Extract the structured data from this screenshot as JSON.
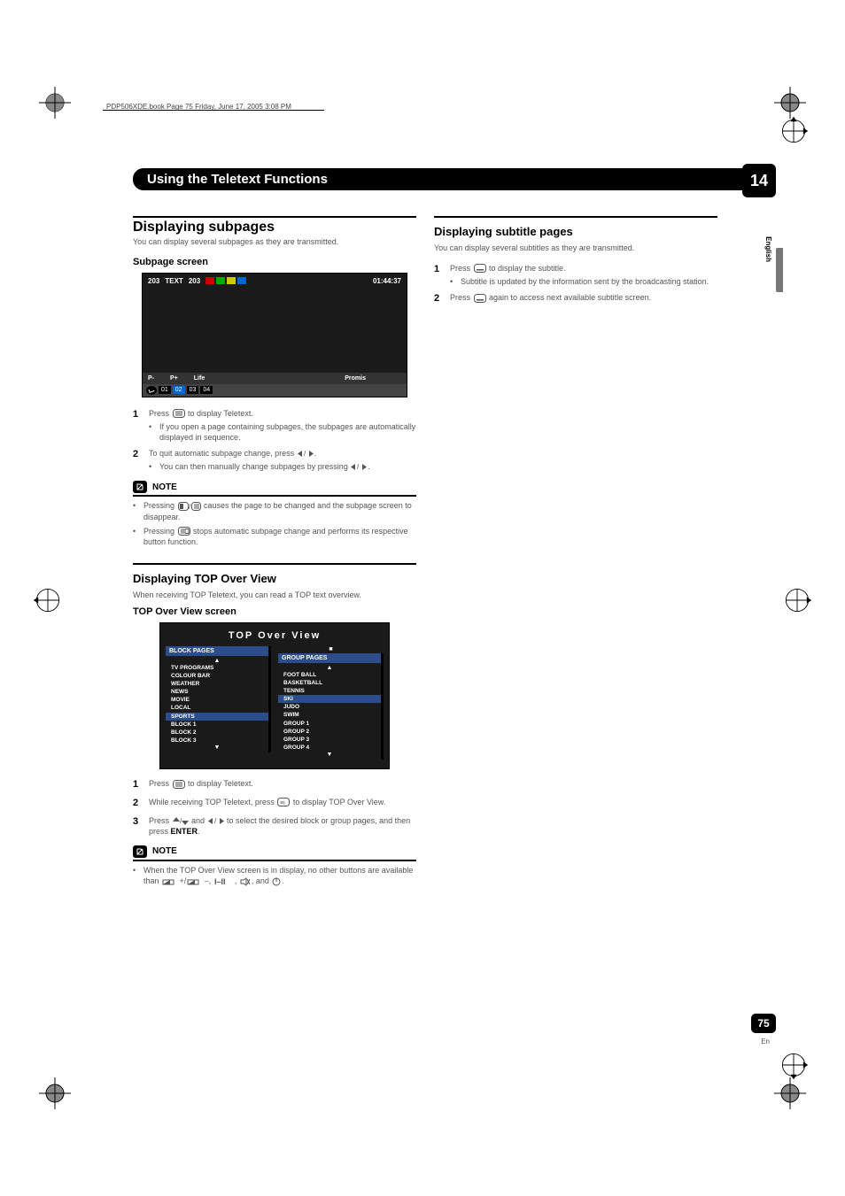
{
  "header_line": "PDP506XDE.book  Page 75  Friday, June 17, 2005  3:08 PM",
  "chapter_title": "Using the Teletext Functions",
  "chapter_number": "14",
  "language_tab": "English",
  "page_number": "75",
  "page_lang": "En",
  "left": {
    "h2": "Displaying subpages",
    "intro": "You can display several subpages as they are transmitted.",
    "h3_subpage": "Subpage screen",
    "ttx": {
      "num_a": "203",
      "label": "TEXT",
      "num_b": "203",
      "time": "01:44:37",
      "bottom": {
        "a": "P-",
        "b": "P+",
        "c": "Life",
        "d": "Promis"
      },
      "subs": [
        "01",
        "02",
        "03",
        "04"
      ]
    },
    "steps": [
      {
        "num": "1",
        "text_before": "Press ",
        "text_after": " to display Teletext.",
        "icon": "teletext",
        "bullets": [
          "If you open a page containing subpages, the subpages are automatically displayed in sequence."
        ]
      },
      {
        "num": "2",
        "text_before": "To quit automatic subpage change, press ",
        "text_after": ".",
        "icon": "leftright",
        "bullets_with_icon": [
          {
            "before": "You can then manually change subpages by pressing ",
            "icon": "leftright",
            "after": "."
          }
        ]
      }
    ],
    "note_label": "NOTE",
    "notes": [
      {
        "before": "Pressing ",
        "icon": "teletext-swap",
        "after": " causes the page to be changed and the subpage screen to disappear."
      },
      {
        "before": "Pressing ",
        "icon": "hold",
        "after": " stops automatic subpage change and performs its respective button function."
      }
    ],
    "h3_top": "Displaying TOP Over View",
    "top_intro": "When receiving TOP Teletext, you can read a TOP text overview.",
    "h3_topscreen": "TOP Over View screen",
    "topview_title": "TOP Over View",
    "block_header": "BLOCK PAGES",
    "group_header": "GROUP PAGES",
    "block_items": [
      {
        "t": "TV PROGRAMS",
        "hl": false
      },
      {
        "t": "COLOUR BAR",
        "hl": false
      },
      {
        "t": "WEATHER",
        "hl": false
      },
      {
        "t": "NEWS",
        "hl": false
      },
      {
        "t": "MOVIE",
        "hl": false
      },
      {
        "t": "LOCAL",
        "hl": false
      },
      {
        "t": "SPORTS",
        "hl": true
      },
      {
        "t": "BLOCK 1",
        "hl": false
      },
      {
        "t": "BLOCK 2",
        "hl": false
      },
      {
        "t": "BLOCK 3",
        "hl": false
      }
    ],
    "group_items": [
      {
        "t": "FOOT BALL",
        "hl": false
      },
      {
        "t": "BASKETBALL",
        "hl": false
      },
      {
        "t": "TENNIS",
        "hl": false
      },
      {
        "t": "SKI",
        "hl": true
      },
      {
        "t": "JUDO",
        "hl": false
      },
      {
        "t": "SWIM",
        "hl": false
      },
      {
        "t": "GROUP 1",
        "hl": false
      },
      {
        "t": "GROUP 2",
        "hl": false
      },
      {
        "t": "GROUP 3",
        "hl": false
      },
      {
        "t": "GROUP 4",
        "hl": false
      }
    ],
    "top_steps": [
      {
        "num": "1",
        "text_before": "Press ",
        "icon": "teletext",
        "text_after": " to display Teletext."
      },
      {
        "num": "2",
        "text_before": "While receiving TOP Teletext, press ",
        "icon": "info",
        "text_after": " to display TOP Over View."
      },
      {
        "num": "3",
        "text_before": "Press ",
        "icon": "updown",
        "mid": " and ",
        "icon2": "leftright",
        "text_after": " to select the desired block or group pages, and then press ",
        "bold_after": "ENTER",
        "tail": "."
      }
    ],
    "note2_label": "NOTE",
    "notes2": [
      {
        "before": "When the TOP Over View screen is in display, no other buttons are available than ",
        "after": "."
      }
    ],
    "note2_buttons": " +/  –, ,  , and "
  },
  "right": {
    "h2": "Displaying subtitle pages",
    "intro": "You can display several subtitles as they are transmitted.",
    "steps": [
      {
        "num": "1",
        "text_before": "Press ",
        "icon": "subtitle",
        "text_after": " to display the subtitle.",
        "bullets": [
          "Subtitle is updated by the information sent by the broadcasting station."
        ]
      },
      {
        "num": "2",
        "text_before": "Press ",
        "icon": "subtitle",
        "text_after": " again to access next available subtitle screen."
      }
    ]
  }
}
